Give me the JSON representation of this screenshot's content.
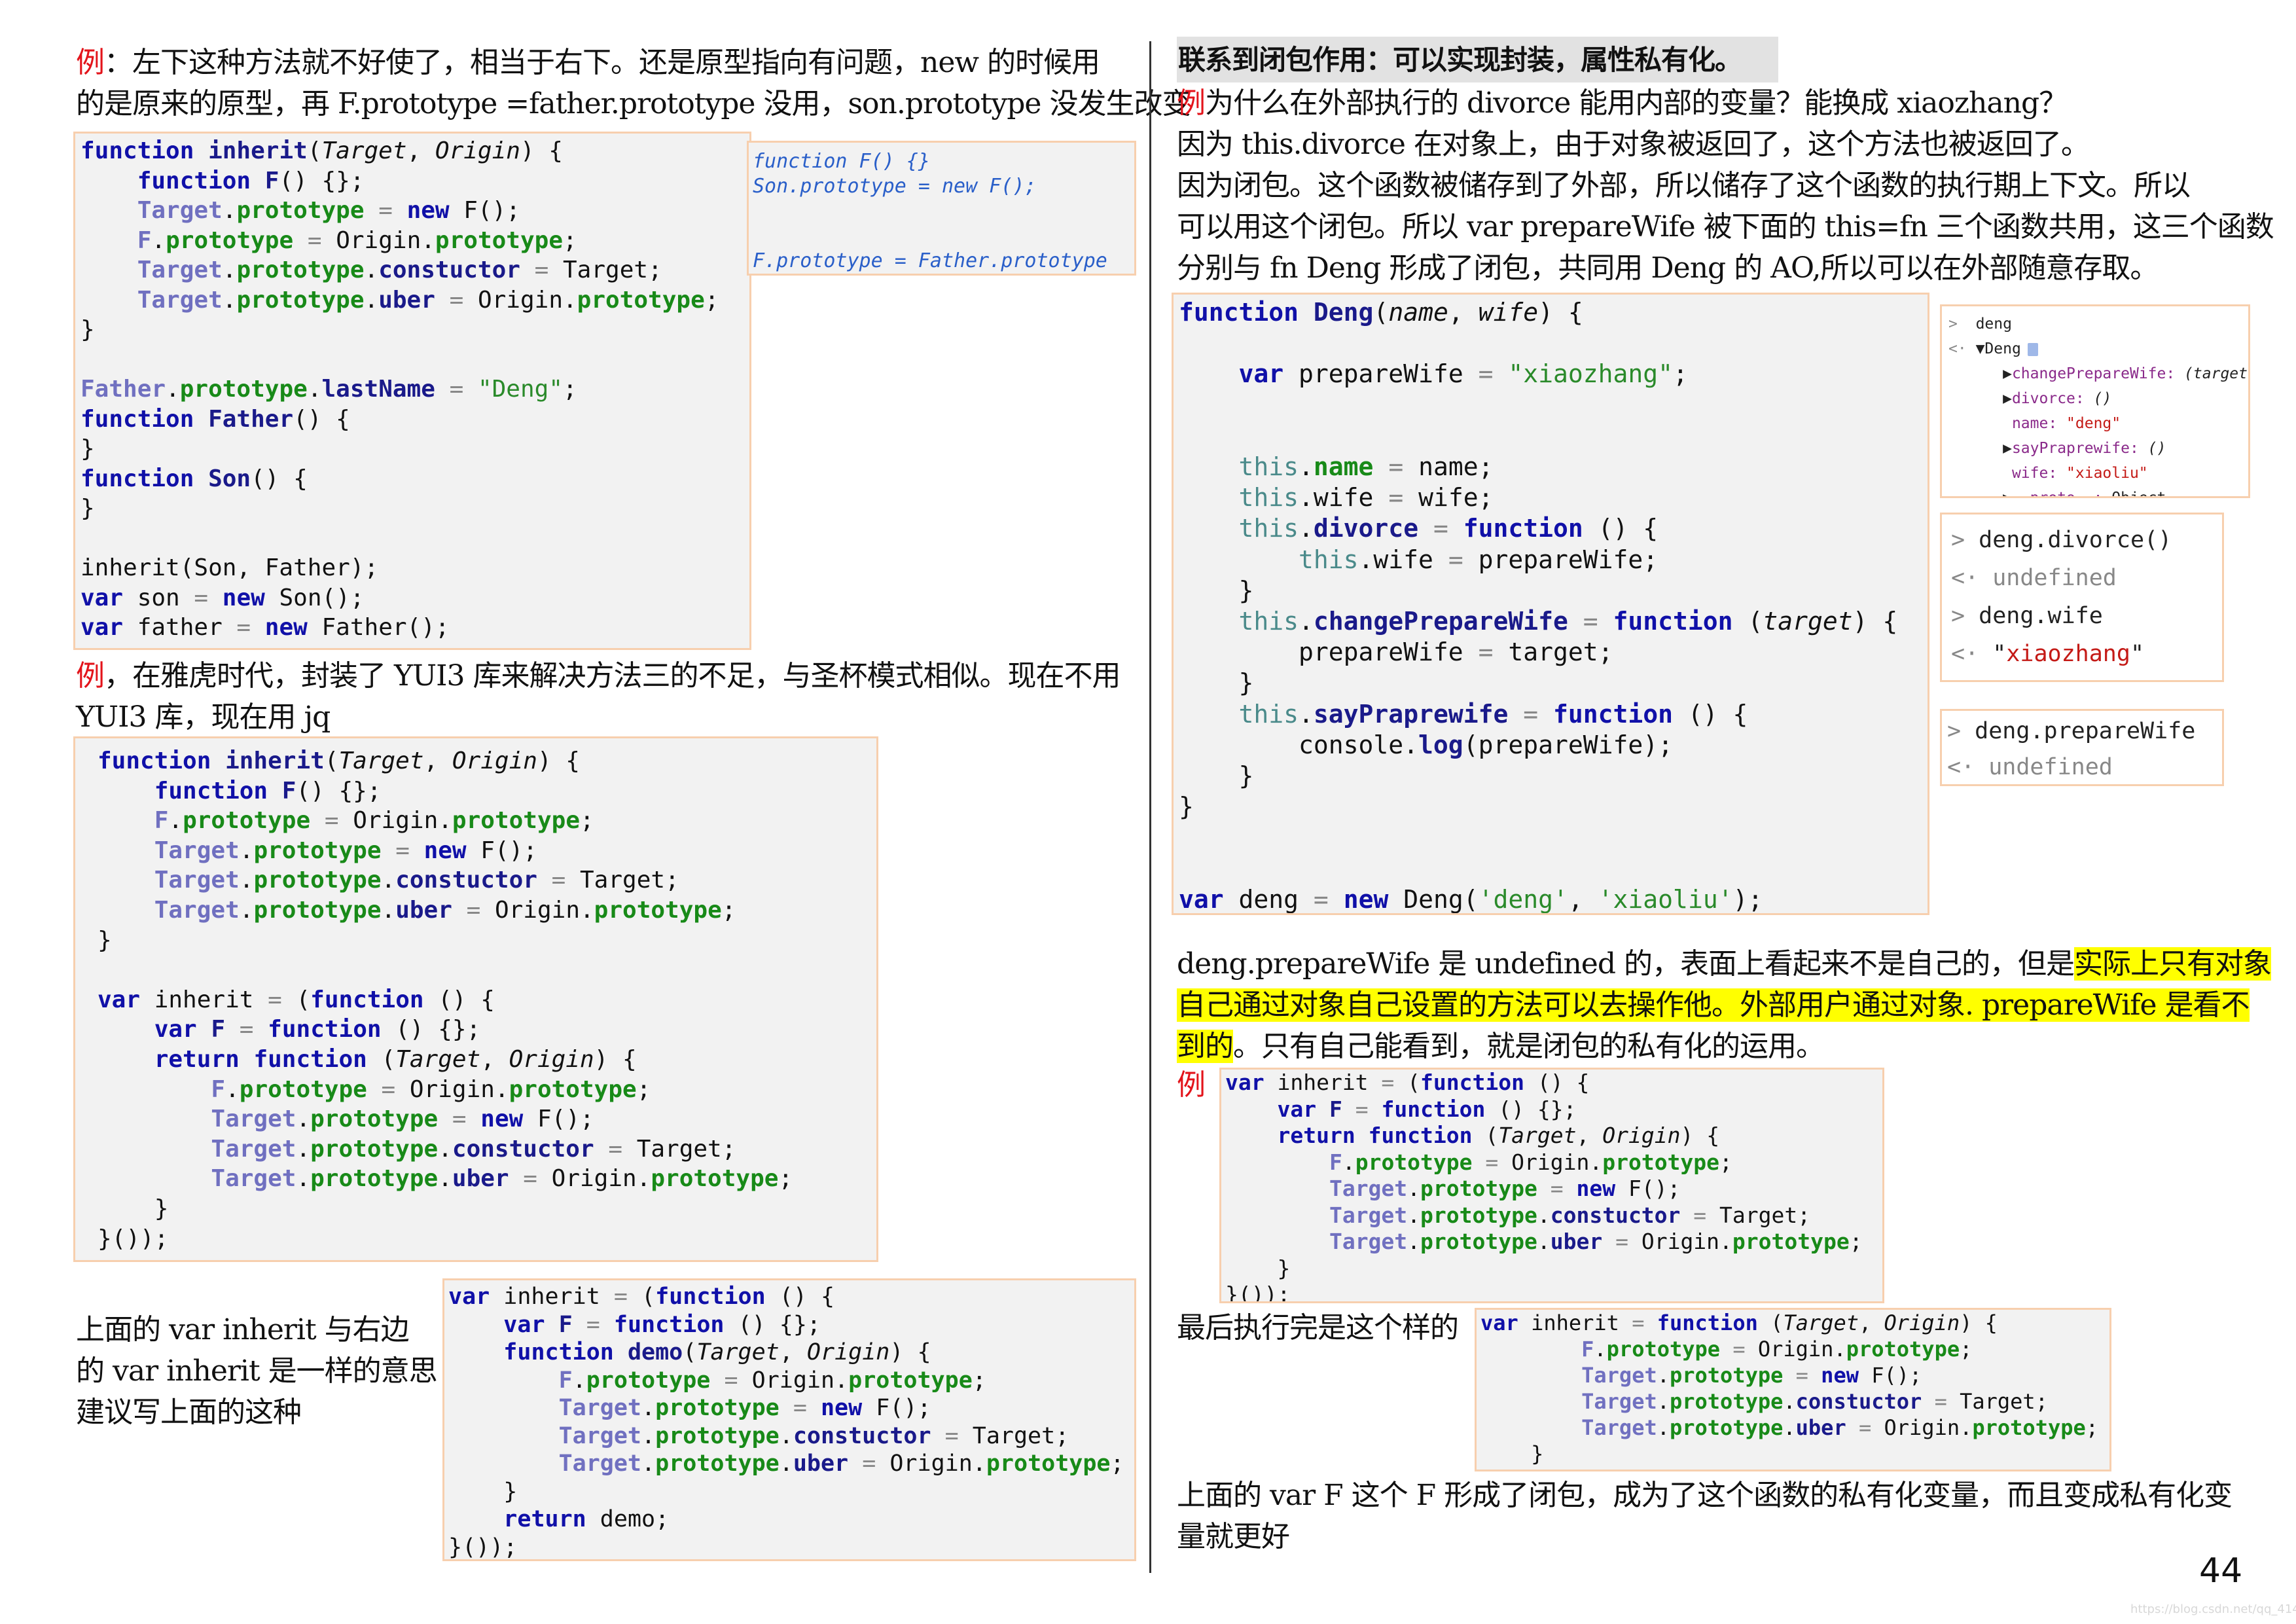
{
  "page_number": "44",
  "watermark_url": "https://blog.csdn.net/qq_41442781",
  "colors": {
    "example_marker": "#e3141b",
    "highlight": "#ffff00",
    "code_border": "#f7cfae",
    "code_bg": "#f2f2f2"
  },
  "left": {
    "para1": {
      "marker": "例",
      "line1": "：左下这种方法就不好使了，相当于右下。还是原型指向有问题，new 的时候用",
      "line2": "的是原来的原型，再 F.prototype =father.prototype 没用，son.prototype 没发生改变"
    },
    "code1": [
      "function inherit(Target, Origin) {",
      "    function F() {};",
      "    Target.prototype = new F();",
      "    F.prototype = Origin.prototype;",
      "    Target.prototype.constuctor = Target;",
      "    Target.prototype.uber = Origin.prototype;",
      "}",
      "",
      "Father.prototype.lastName = \"Deng\";",
      "function Father() {",
      "}",
      "function Son() {",
      "}",
      "",
      "inherit(Son, Father);",
      "var son = new Son();",
      "var father = new Father();"
    ],
    "side_code": [
      "function F() {}",
      "Son.prototype = new F();",
      "",
      "",
      "F.prototype = Father.prototype"
    ],
    "para2": {
      "marker": "例",
      "line1": "，在雅虎时代，封装了 YUI3 库来解决方法三的不足，与圣杯模式相似。现在不用",
      "line2": "YUI3 库，现在用 jq"
    },
    "code2": [
      "function inherit(Target, Origin) {",
      "    function F() {};",
      "    F.prototype = Origin.prototype;",
      "    Target.prototype = new F();",
      "    Target.prototype.constuctor = Target;",
      "    Target.prototype.uber = Origin.prototype;",
      "}",
      "",
      "var inherit = (function () {",
      "    var F = function () {};",
      "    return function (Target, Origin) {",
      "        F.prototype = Origin.prototype;",
      "        Target.prototype = new F();",
      "        Target.prototype.constuctor = Target;",
      "        Target.prototype.uber = Origin.prototype;",
      "    }",
      "}());"
    ],
    "note": [
      "上面的 var inherit 与右边",
      "的 var inherit 是一样的意思",
      "建议写上面的这种"
    ],
    "code3": [
      "var inherit = (function () {",
      "    var F = function () {};",
      "    function demo(Target, Origin) {",
      "        F.prototype = Origin.prototype;",
      "        Target.prototype = new F();",
      "        Target.prototype.constuctor = Target;",
      "        Target.prototype.uber = Origin.prototype;",
      "    }",
      "    return demo;",
      "}());"
    ]
  },
  "right": {
    "heading": "联系到闭包作用：可以实现封装，属性私有化。",
    "para1": {
      "marker": "例",
      "line1": "为什么在外部执行的 divorce 能用内部的变量？能换成 xiaozhang？",
      "line2": "因为 this.divorce 在对象上，由于对象被返回了，这个方法也被返回了。",
      "line3": "因为闭包。这个函数被储存到了外部，所以储存了这个函数的执行期上下文。所以",
      "line4": "可以用这个闭包。所以 var prepareWife 被下面的 this=fn 三个函数共用，这三个函数",
      "line5": "分别与 fn Deng 形成了闭包，共同用 Deng 的 AO,所以可以在外部随意存取。"
    },
    "deng_code": [
      "function Deng(name, wife) {",
      "",
      "    var prepareWife = \"xiaozhang\";",
      "",
      "",
      "    this.name = name;",
      "    this.wife = wife;",
      "    this.divorce = function () {",
      "        this.wife = prepareWife;",
      "    }",
      "    this.changePrepareWife = function (target) {",
      "        prepareWife = target;",
      "    }",
      "    this.sayPraprewife = function () {",
      "        console.log(prepareWife);",
      "    }",
      "}",
      "",
      "",
      "var deng = new Deng('deng', 'xiaoliu');"
    ],
    "devtools1": {
      "input": "deng",
      "object": "Deng",
      "props": [
        {
          "key": "changePrepareWife",
          "value": "(target)",
          "expandable": true
        },
        {
          "key": "divorce",
          "value": "()",
          "expandable": true
        },
        {
          "key": "name",
          "value": "\"deng\"",
          "expandable": false
        },
        {
          "key": "sayPraprewife",
          "value": "()",
          "expandable": true
        },
        {
          "key": "wife",
          "value": "\"xiaoliu\"",
          "expandable": false
        },
        {
          "key": "__proto__",
          "value": "Object",
          "expandable": true
        }
      ]
    },
    "devtools2": [
      {
        "type": "in",
        "text": "deng.divorce()"
      },
      {
        "type": "out",
        "text": "undefined"
      },
      {
        "type": "in",
        "text": "deng.wife"
      },
      {
        "type": "out",
        "text": "\"xiaozhang\""
      }
    ],
    "devtools3": [
      {
        "type": "in",
        "text": "deng.prepareWife"
      },
      {
        "type": "out",
        "text": "undefined"
      }
    ],
    "para2": {
      "plain1": "deng.prepareWife 是 undefined 的，表面上看起来不是自己的，但是",
      "hl1": "实际上只有对象",
      "hl2": "自己通过对象自己设置的方法可以去操作他。外部用户通过对象. prepareWife 是看不",
      "hl3": "到的",
      "plain2": "。只有自己能看到，就是闭包的私有化的运用。"
    },
    "example_marker": "例",
    "code4": [
      "var inherit = (function () {",
      "    var F = function () {};",
      "    return function (Target, Origin) {",
      "        F.prototype = Origin.prototype;",
      "        Target.prototype = new F();",
      "        Target.prototype.constuctor = Target;",
      "        Target.prototype.uber = Origin.prototype;",
      "    }",
      "}());"
    ],
    "final_label": "最后执行完是这个样的",
    "code5": [
      "var inherit = function (Target, Origin) {",
      "        F.prototype = Origin.prototype;",
      "        Target.prototype = new F();",
      "        Target.prototype.constuctor = Target;",
      "        Target.prototype.uber = Origin.prototype;",
      "    }"
    ],
    "para3": {
      "line1": "上面的 var F 这个 F 形成了闭包，成为了这个函数的私有化变量，而且变成私有化变",
      "line2": "量就更好"
    }
  }
}
